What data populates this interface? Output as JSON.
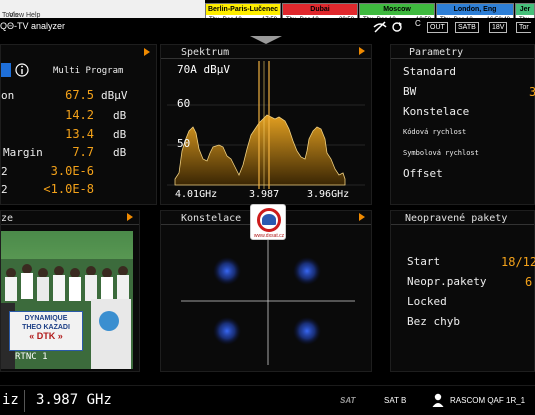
{
  "menu": [
    "Tools",
    "View",
    "Help"
  ],
  "clocks": [
    {
      "city": "Berlin-Paris-Lučenec",
      "day": "Thu, Dec 18",
      "time": "17:58",
      "color": "#ffee00"
    },
    {
      "city": "Dubai",
      "day": "Thu, Dec 18",
      "time": "20:58",
      "color": "#e0282d"
    },
    {
      "city": "Moscow",
      "day": "Thu, Dec 18",
      "time": "19:58",
      "color": "#3fb93f"
    },
    {
      "city": "London, Eng",
      "day": "Thu, Dec 18",
      "time": "16:58:48",
      "color": "#2e7fd6"
    },
    {
      "city": "Jer",
      "day": "Thu, I",
      "time": "",
      "color": "#46c07a"
    }
  ],
  "app_title": "QΘ-TV analyzer",
  "status": {
    "c": "C",
    "out": "OUT",
    "satb": "SATB",
    "voltage": "18V",
    "tone": "Tor"
  },
  "signal_panel": {
    "mode": "Multi Program",
    "rows": [
      {
        "label": "on",
        "value": "67.5",
        "unit": "dBµV"
      },
      {
        "label": "",
        "value": "14.2",
        "unit": "dB"
      },
      {
        "label": "",
        "value": "13.4",
        "unit": "dB"
      },
      {
        "label": "Margin",
        "value": "7.7",
        "unit": "dB"
      },
      {
        "label": "2",
        "value": "3.0E-6",
        "unit": ""
      },
      {
        "label": "2",
        "value": "<1.0E-8",
        "unit": ""
      }
    ]
  },
  "spectrum": {
    "title": "Spektrum",
    "ref_level": "70A dBµV",
    "y_ticks": [
      "60",
      "50"
    ],
    "x_labels": [
      "4.01GHz",
      "3.987",
      "3.96GHz"
    ]
  },
  "parameters": {
    "title": "Parametry",
    "rows": [
      {
        "label": "Standard",
        "value": ""
      },
      {
        "label": "BW",
        "value": "3"
      },
      {
        "label": "Konstelace",
        "value": ""
      },
      {
        "label": "Kódová rychlost",
        "value": ""
      },
      {
        "label": "Symbolová rychlost",
        "value": ""
      },
      {
        "label": "Offset",
        "value": ""
      }
    ]
  },
  "video_panel": {
    "title": "ze",
    "banner_line1": "DYNAMIQUE",
    "banner_line2": "THEO KAZADI",
    "banner_line3": "« DTK »",
    "channel_overlay": "RTNC 1"
  },
  "constellation": {
    "title": "Konstelace"
  },
  "logo": {
    "site": "www.dxsat.cz"
  },
  "errors_panel": {
    "title": "Neopravené pakety",
    "rows": [
      {
        "label": "Start",
        "value": "18/12"
      },
      {
        "label": "Neopr.pakety",
        "value": "6"
      },
      {
        "label": "Locked",
        "value": ""
      },
      {
        "label": "Bez chyb",
        "value": ""
      }
    ]
  },
  "bottom": {
    "left_fragment": "iz",
    "frequency": "3.987 GHz",
    "sat_logo": "SAT",
    "lnb": "SAT B",
    "satellite": "RASCOM QAF 1R_1"
  }
}
